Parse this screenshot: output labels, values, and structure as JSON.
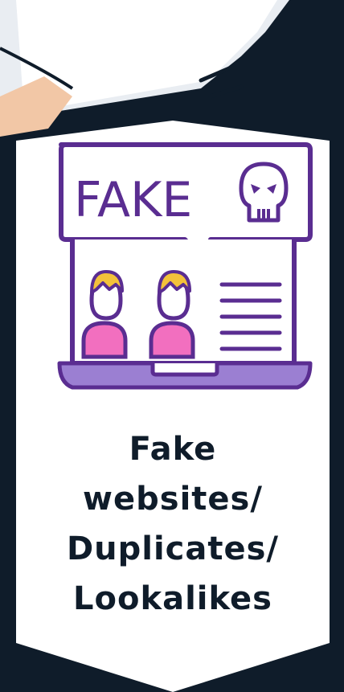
{
  "illustration": {
    "sign_text": "FAKE",
    "icon_skull": "skull-icon",
    "icon_people": "user-icon",
    "icon_lines": "text-lines-icon",
    "colors": {
      "outline": "#5a2d91",
      "hair": "#f3c23a",
      "shirt": "#f26fbf",
      "base": "#9b7fd2",
      "background": "#0f1c2a",
      "card": "#ffffff"
    }
  },
  "caption": {
    "line1": "Fake",
    "line2": "websites/",
    "line3": "Duplicates/",
    "line4": "Lookalikes"
  }
}
